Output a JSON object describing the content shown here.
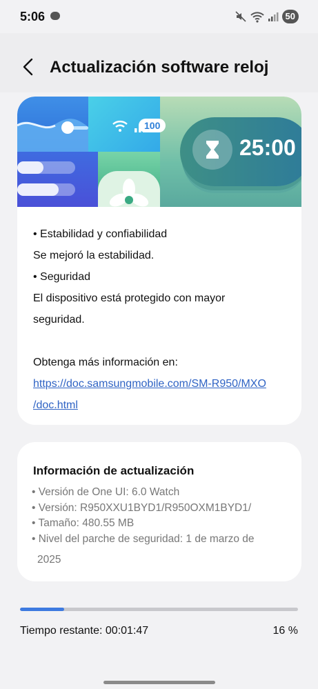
{
  "status_bar": {
    "time": "5:06",
    "battery": "50",
    "icons": [
      "mute-icon",
      "wifi-icon",
      "signal-icon"
    ]
  },
  "header": {
    "title": "Actualización software reloj",
    "back_icon": "chevron-left-icon"
  },
  "banner": {
    "timer": "25:00",
    "battery_chip": "100",
    "icons": [
      "hourglass-icon",
      "wifi-icon",
      "signal-icon",
      "fan-icon"
    ]
  },
  "release_notes": {
    "items": [
      "• Estabilidad y confiabilidad",
      "Se mejoró la estabilidad.",
      "• Seguridad",
      "El dispositivo está protegido con mayor",
      "seguridad."
    ],
    "more_info_label": "Obtenga más información en:",
    "link_line1": "https://doc.samsungmobile.com/SM-R950/MXO",
    "link_line2": "/doc.html"
  },
  "update_info": {
    "title": "Información de actualización",
    "lines": [
      "• Versión de One UI: 6.0 Watch",
      "• Versión: R950XXU1BYD1/R950OXM1BYD1/",
      "• Tamaño: 480.55 MB",
      "• Nivel del parche de seguridad: 1 de marzo de",
      "2025"
    ]
  },
  "progress": {
    "remaining_text": "Tiempo restante: 00:01:47",
    "percent_text": "16 %",
    "value": 0.16,
    "accent_color": "#3d7ae0"
  }
}
